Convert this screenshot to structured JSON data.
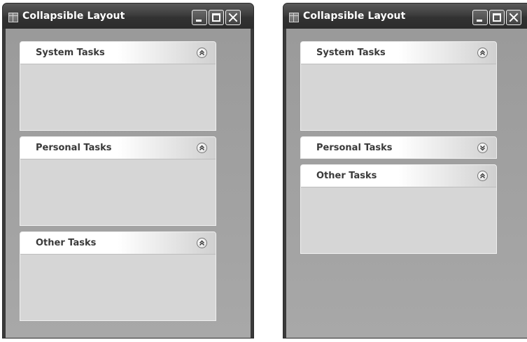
{
  "windows": [
    {
      "title": "Collapsible Layout",
      "panels": [
        {
          "title": "System Tasks",
          "state": "expanded",
          "toggle_icon": "collapse-chevrons-up-icon"
        },
        {
          "title": "Personal Tasks",
          "state": "expanded",
          "toggle_icon": "collapse-chevrons-up-icon"
        },
        {
          "title": "Other Tasks",
          "state": "expanded",
          "toggle_icon": "collapse-chevrons-up-icon"
        }
      ]
    },
    {
      "title": "Collapsible Layout",
      "panels": [
        {
          "title": "System Tasks",
          "state": "expanded",
          "toggle_icon": "collapse-chevrons-up-icon"
        },
        {
          "title": "Personal Tasks",
          "state": "collapsed",
          "toggle_icon": "expand-chevrons-down-icon"
        },
        {
          "title": "Other Tasks",
          "state": "expanded",
          "toggle_icon": "collapse-chevrons-up-icon"
        }
      ]
    }
  ]
}
